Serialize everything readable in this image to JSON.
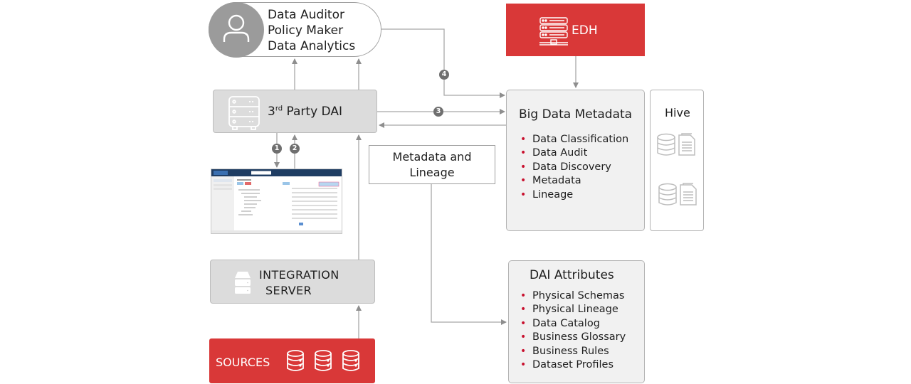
{
  "users": {
    "roles": [
      "Data Auditor",
      "Policy Maker",
      "Data Analytics"
    ],
    "icon": "user-icon"
  },
  "edh": {
    "label": "EDH",
    "icon": "server-rack-icon",
    "color": "#d93838"
  },
  "third_party_dai": {
    "label_prefix": "3",
    "label_sup": "rd",
    "label_suffix": " Party DAI",
    "icon": "server-icon"
  },
  "big_data_metadata": {
    "title": "Big Data Metadata",
    "items": [
      "Data Classification",
      "Data Audit",
      "Data Discovery",
      "Metadata",
      "Lineage"
    ]
  },
  "hive": {
    "title": "Hive",
    "icons": [
      "database-document-icon",
      "database-document-icon"
    ]
  },
  "metadata_lineage": {
    "label_line1": "Metadata and",
    "label_line2": "Lineage"
  },
  "integration_server": {
    "label_line1": "INTEGRATION",
    "label_line2": "SERVER",
    "icon": "server-stack-icon"
  },
  "sources": {
    "label": "SOURCES",
    "icons": [
      "database-icon",
      "database-icon",
      "database-icon"
    ],
    "color": "#d93838"
  },
  "dai_attributes": {
    "title": "DAI Attributes",
    "items": [
      "Physical Schemas",
      "Physical Lineage",
      "Data Catalog",
      "Business Glossary",
      "Business Rules",
      "Dataset Profiles"
    ]
  },
  "steps": {
    "s1": "1",
    "s2": "2",
    "s3": "3",
    "s4": "4"
  },
  "colors": {
    "accent_red": "#d93838",
    "bullet_red": "#c8102e",
    "connector": "#9a9a9a",
    "badge": "#6f6f6f"
  }
}
